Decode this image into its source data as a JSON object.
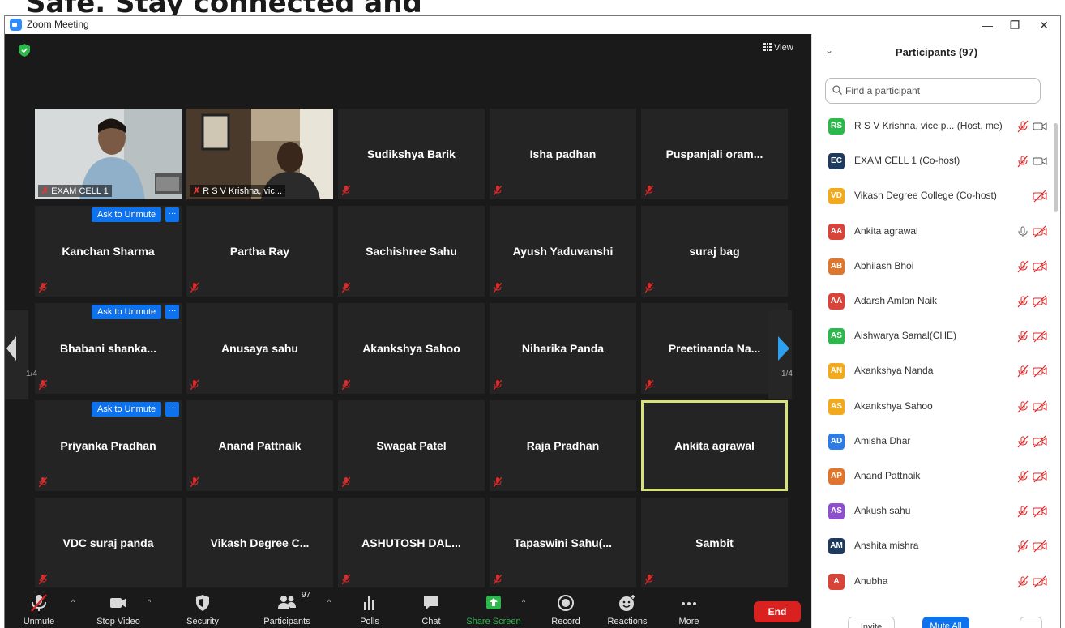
{
  "banner": {
    "text": "Safe. Stay connected and"
  },
  "window": {
    "title": "Zoom Meeting",
    "minimize": "—",
    "restore": "❐",
    "close": "✕"
  },
  "meeting": {
    "view_label": "View"
  },
  "video_tiles": [
    {
      "name": "EXAM CELL 1"
    },
    {
      "name": "R S V Krishna, vic..."
    }
  ],
  "tiles": [
    {
      "name": "Sudikshya Barik",
      "muted": true
    },
    {
      "name": "Isha padhan",
      "muted": true
    },
    {
      "name": "Puspanjali oram...",
      "muted": true
    },
    {
      "name": "Kanchan Sharma",
      "muted": true,
      "ask_unmute": true
    },
    {
      "name": "Partha Ray",
      "muted": true
    },
    {
      "name": "Sachishree Sahu",
      "muted": true
    },
    {
      "name": "Ayush Yaduvanshi",
      "muted": true
    },
    {
      "name": "suraj bag",
      "muted": true
    },
    {
      "name": "Bhabani shanka...",
      "muted": true,
      "ask_unmute": true
    },
    {
      "name": "Anusaya sahu",
      "muted": true
    },
    {
      "name": "Akankshya Sahoo",
      "muted": true
    },
    {
      "name": "Niharika Panda",
      "muted": true
    },
    {
      "name": "Preetinanda Na...",
      "muted": true
    },
    {
      "name": "Priyanka Pradhan",
      "muted": true,
      "ask_unmute": true
    },
    {
      "name": "Anand Pattnaik",
      "muted": true
    },
    {
      "name": "Swagat Patel",
      "muted": true
    },
    {
      "name": "Raja Pradhan",
      "muted": true
    },
    {
      "name": "Ankita agrawal",
      "muted": false,
      "active": true
    },
    {
      "name": "VDC suraj panda",
      "muted": true
    },
    {
      "name": "Vikash Degree C...",
      "muted": false
    },
    {
      "name": "ASHUTOSH DAL...",
      "muted": true
    },
    {
      "name": "Tapaswini Sahu(...",
      "muted": true
    },
    {
      "name": "Sambit",
      "muted": true
    }
  ],
  "ask_unmute_label": "Ask to Unmute",
  "ask_more_label": "···",
  "pager": {
    "left": "1/4",
    "right": "1/4"
  },
  "toolbar": {
    "unmute": "Unmute",
    "stop_video": "Stop Video",
    "security": "Security",
    "participants": "Participants",
    "participants_count": "97",
    "polls": "Polls",
    "chat": "Chat",
    "share_screen": "Share Screen",
    "record": "Record",
    "reactions": "Reactions",
    "more": "More",
    "end": "End"
  },
  "panel": {
    "title": "Participants (97)",
    "search_placeholder": "Find a participant",
    "invite": "Invite",
    "mute_all": "Mute All",
    "more": "..."
  },
  "participants": [
    {
      "initials": "RS",
      "color": "#2eb84c",
      "name": "R S V Krishna, vice p...  (Host, me)",
      "icons": "mic-muted video"
    },
    {
      "initials": "EC",
      "color": "#1f3a5f",
      "name": "EXAM CELL 1 (Co-host)",
      "icons": "mic-muted video"
    },
    {
      "initials": "VD",
      "color": "#f2a91e",
      "name": "Vikash Degree College (Co-host)",
      "icons": "video-off"
    },
    {
      "initials": "AA",
      "color": "#d94339",
      "name": "Ankita agrawal",
      "icons": "mic video-off"
    },
    {
      "initials": "AB",
      "color": "#e0762b",
      "name": "Abhilash Bhoi",
      "icons": "mic-muted video-off"
    },
    {
      "initials": "AA",
      "color": "#d94339",
      "name": "Adarsh Amlan Naik",
      "icons": "mic-muted video-off"
    },
    {
      "initials": "AS",
      "color": "#2eb84c",
      "name": "Aishwarya Samal(CHE)",
      "icons": "mic-muted video-off"
    },
    {
      "initials": "AN",
      "color": "#f2a91e",
      "name": "Akankshya Nanda",
      "icons": "mic-muted video-off"
    },
    {
      "initials": "AS",
      "color": "#f2a91e",
      "name": "Akankshya Sahoo",
      "icons": "mic-muted video-off"
    },
    {
      "initials": "AD",
      "color": "#2d7be6",
      "name": "Amisha Dhar",
      "icons": "mic-muted video-off"
    },
    {
      "initials": "AP",
      "color": "#e0762b",
      "name": "Anand Pattnaik",
      "icons": "mic-muted video-off"
    },
    {
      "initials": "AS",
      "color": "#8e4fcf",
      "name": "Ankush sahu",
      "icons": "mic-muted video-off"
    },
    {
      "initials": "AM",
      "color": "#1f3a5f",
      "name": "Anshita mishra",
      "icons": "mic-muted video-off"
    },
    {
      "initials": "A",
      "color": "#d94339",
      "name": "Anubha",
      "icons": "mic-muted video-off"
    }
  ]
}
